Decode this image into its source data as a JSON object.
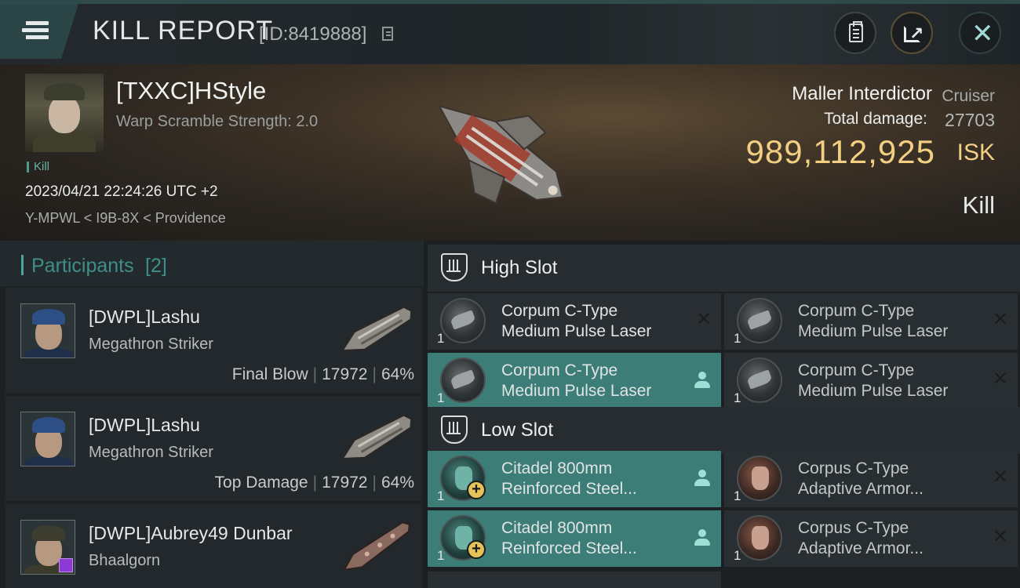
{
  "header": {
    "title": "KILL REPORT",
    "report_id": "[ID:8419888]"
  },
  "victim": {
    "name": "[TXXC]HStyle",
    "stat": "Warp Scramble Strength: 2.0",
    "tag": "Kill",
    "datetime": "2023/04/21 22:24:26 UTC +2",
    "location": "Y-MPWL < I9B-8X < Providence",
    "ship_name": "Maller Interdictor",
    "ship_class": "Cruiser",
    "total_damage_label": "Total damage:",
    "total_damage": "27703",
    "isk_value": "989,112,925",
    "isk_unit": "ISK",
    "result": "Kill"
  },
  "participants": {
    "title": "Participants",
    "count": "[2]",
    "items": [
      {
        "name": "[DWPL]Lashu",
        "ship": "Megathron Striker",
        "role": "Final Blow",
        "damage": "17972",
        "percent": "64%"
      },
      {
        "name": "[DWPL]Lashu",
        "ship": "Megathron Striker",
        "role": "Top Damage",
        "damage": "17972",
        "percent": "64%"
      },
      {
        "name": "[DWPL]Aubrey49 Dunbar",
        "ship": "Bhaalgorn"
      }
    ]
  },
  "fitting": {
    "high_slot": {
      "title": "High Slot",
      "modules": [
        {
          "line1": "Corpum C-Type",
          "line2": "Medium Pulse Laser",
          "qty": "1",
          "state": "destroyed"
        },
        {
          "line1": "Corpum C-Type",
          "line2": "Medium Pulse Laser",
          "qty": "1",
          "state": "destroyed"
        },
        {
          "line1": "Corpum C-Type",
          "line2": "Medium Pulse Laser",
          "qty": "1",
          "state": "dropped"
        },
        {
          "line1": "Corpum C-Type",
          "line2": "Medium Pulse Laser",
          "qty": "1",
          "state": "destroyed"
        }
      ]
    },
    "low_slot": {
      "title": "Low Slot",
      "modules": [
        {
          "line1": "Citadel 800mm",
          "line2": "Reinforced Steel...",
          "qty": "1",
          "state": "dropped"
        },
        {
          "line1": "Corpus C-Type",
          "line2": "Adaptive Armor...",
          "qty": "1",
          "state": "destroyed"
        },
        {
          "line1": "Citadel 800mm",
          "line2": "Reinforced Steel...",
          "qty": "1",
          "state": "dropped"
        },
        {
          "line1": "Corpus C-Type",
          "line2": "Adaptive Armor...",
          "qty": "1",
          "state": "destroyed"
        }
      ]
    }
  },
  "icons": {
    "menu": "hamburger-icon",
    "copy": "copy-icon",
    "clipboard": "clipboard-icon",
    "share": "share-icon",
    "close": "close-icon",
    "slot": "turret-slot-icon",
    "fitted": "pilot-icon",
    "destroyed": "x-icon"
  },
  "colors": {
    "accent": "#3d7d77",
    "isk": "#f2cf83",
    "participants_title": "#3f8f88"
  }
}
